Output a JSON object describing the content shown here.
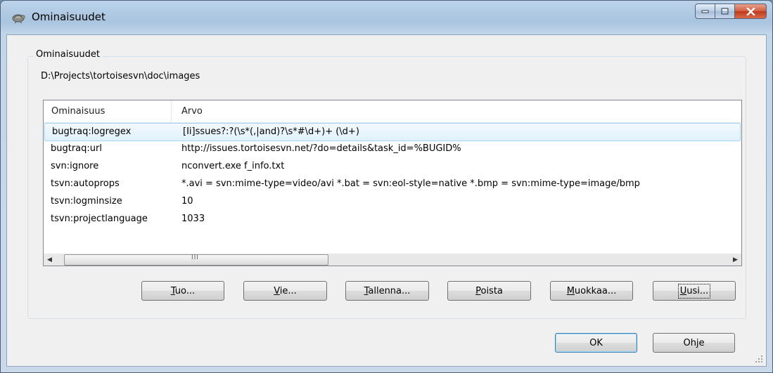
{
  "window": {
    "title": "Ominaisuudet"
  },
  "group": {
    "label": "Ominaisuudet",
    "path": "D:\\Projects\\tortoisesvn\\doc\\images"
  },
  "list": {
    "columns": [
      "Ominaisuus",
      "Arvo"
    ],
    "rows": [
      {
        "name": "bugtraq:logregex",
        "value": "[Ii]ssues?:?(\\s*(,|and)?\\s*#\\d+)+ (\\d+)",
        "selected": true
      },
      {
        "name": "bugtraq:url",
        "value": "http://issues.tortoisesvn.net/?do=details&task_id=%BUGID%"
      },
      {
        "name": "svn:ignore",
        "value": "nconvert.exe f_info.txt"
      },
      {
        "name": "tsvn:autoprops",
        "value": "*.avi = svn:mime-type=video/avi *.bat = svn:eol-style=native *.bmp = svn:mime-type=image/bmp"
      },
      {
        "name": "tsvn:logminsize",
        "value": "10"
      },
      {
        "name": "tsvn:projectlanguage",
        "value": "1033"
      }
    ],
    "scroll_grip": "III"
  },
  "actions": {
    "import_label": "Tuo...",
    "export_label": "Vie...",
    "save_label": "Tallenna...",
    "remove_label": "Poista",
    "edit_label": "Muokkaa...",
    "new_label": "Uusi..."
  },
  "footer": {
    "ok_label": "OK",
    "help_label": "Ohje"
  },
  "icons": {
    "app": "tortoise-icon",
    "minimize": "minimize-icon",
    "maximize": "maximize-icon",
    "close": "close-icon"
  }
}
